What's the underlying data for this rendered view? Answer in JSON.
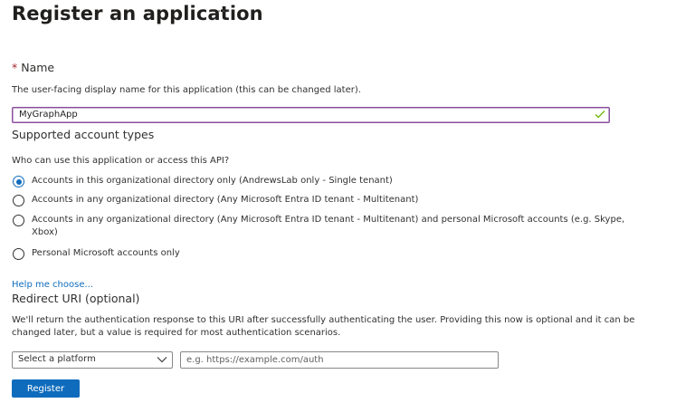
{
  "page": {
    "title": "Register an application",
    "more_label": "···"
  },
  "name_section": {
    "required_mark": "*",
    "label": "Name",
    "description": "The user-facing display name for this application (this can be changed later).",
    "value": "MyGraphApp",
    "valid_icon": "checkmark-icon"
  },
  "account_types": {
    "heading": "Supported account types",
    "question": "Who can use this application or access this API?",
    "selected_index": 0,
    "options": [
      {
        "label": "Accounts in this organizational directory only (AndrewsLab only - Single tenant)",
        "checked": true
      },
      {
        "label": "Accounts in any organizational directory (Any Microsoft Entra ID tenant - Multitenant)",
        "checked": false
      },
      {
        "label_line1": "Accounts in any organizational directory (Any Microsoft Entra ID tenant - Multitenant) and personal Microsoft accounts (e.g. Skype,",
        "label_line2": "Xbox)",
        "checked": false
      },
      {
        "label": "Personal Microsoft accounts only",
        "checked": false
      }
    ],
    "help_link": "Help me choose..."
  },
  "redirect": {
    "heading": "Redirect URI (optional)",
    "description_line1": "We'll return the authentication response to this URI after successfully authenticating the user. Providing this now is optional and it can be",
    "description_line2": "changed later, but a value is required for most authentication scenarios.",
    "platform_select": "Select a platform",
    "uri_placeholder": "e.g. https://example.com/auth"
  },
  "actions": {
    "register_label": "Register"
  },
  "colors": {
    "accent": "#0f6cbd",
    "required": "#a4262c",
    "valid": "#107c10",
    "focus_border": "#8a4f9e"
  }
}
